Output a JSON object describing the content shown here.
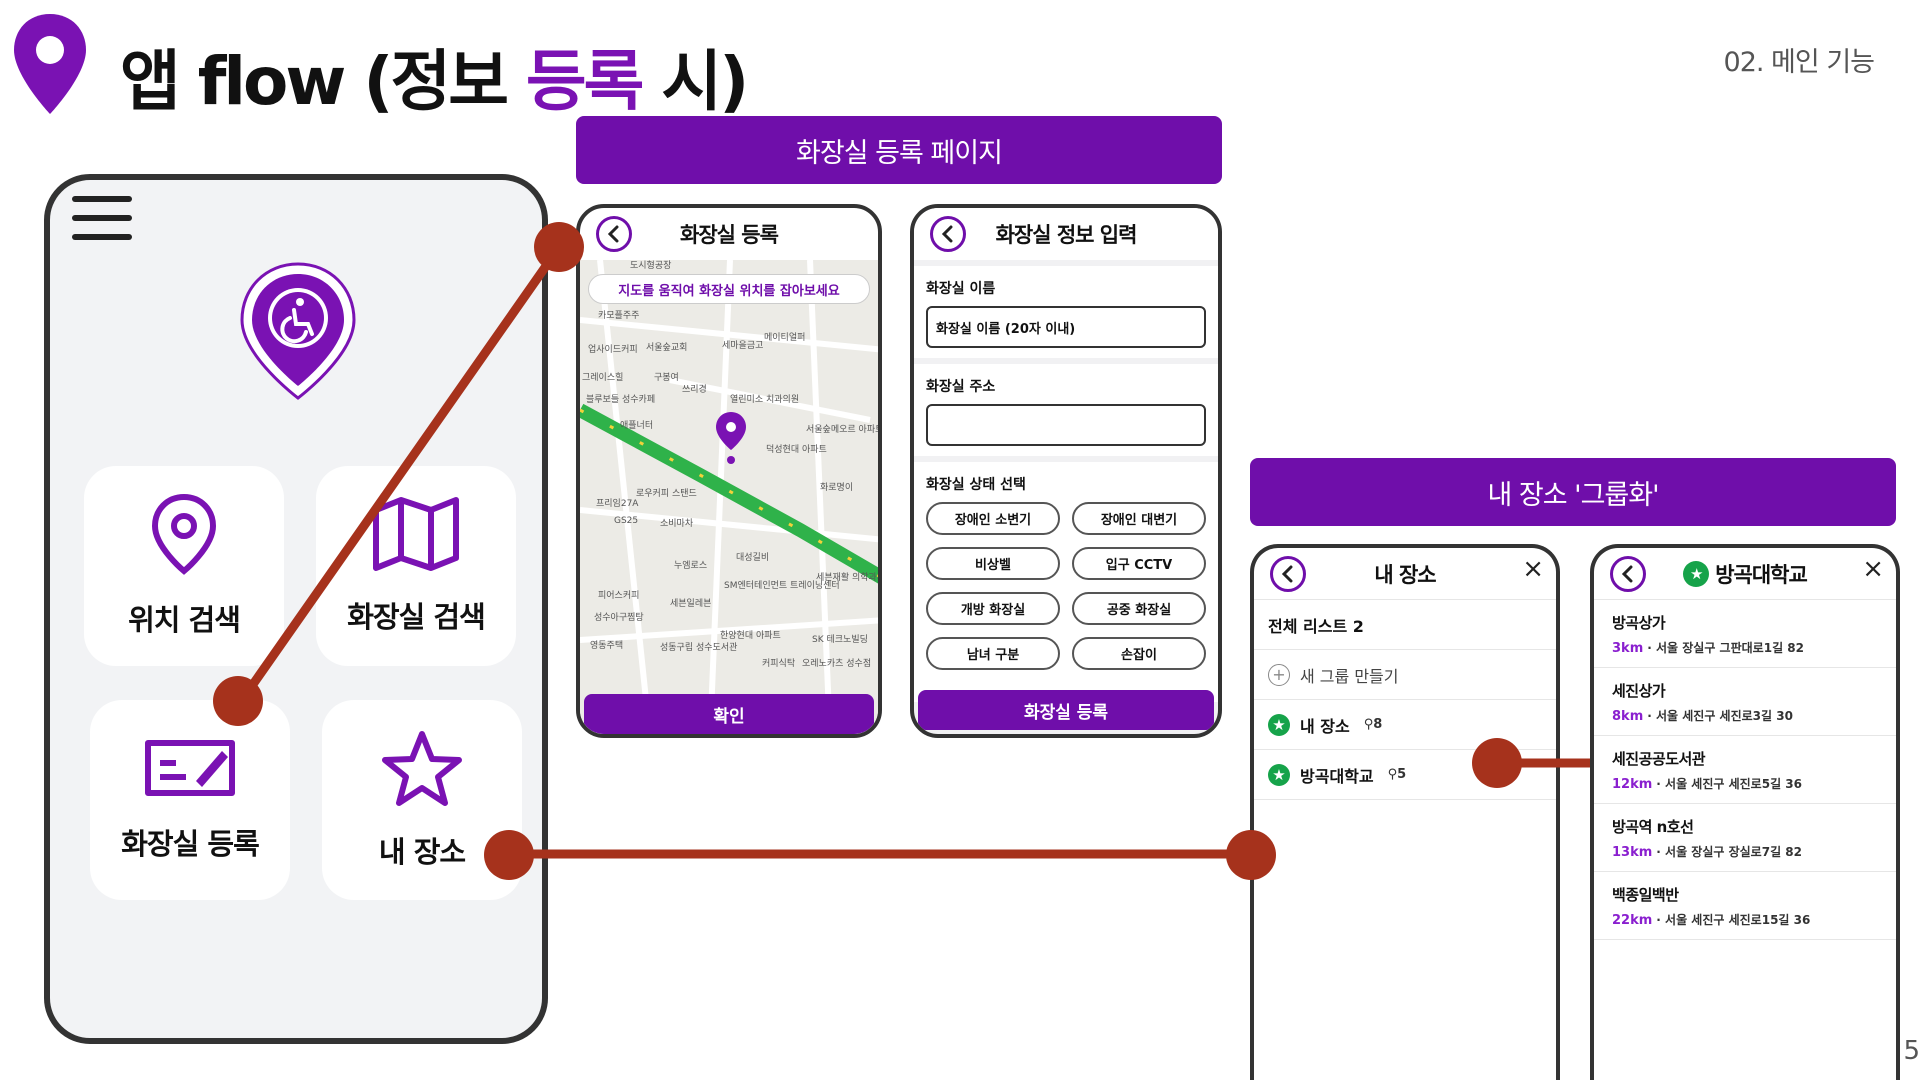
{
  "header": {
    "title_prefix": "앱 flow (정보 ",
    "title_accent": "등록",
    "title_suffix": " 시)",
    "section": "02. 메인 기능",
    "page_number": "5"
  },
  "home": {
    "tiles": [
      {
        "label": "위치 검색",
        "icon": "location-pin-icon"
      },
      {
        "label": "화장실 검색",
        "icon": "map-icon"
      },
      {
        "label": "화장실 등록",
        "icon": "ticket-edit-icon"
      },
      {
        "label": "내 장소",
        "icon": "star-icon"
      }
    ]
  },
  "banners": {
    "register": "화장실 등록 페이지",
    "group": "내 장소 '그룹화'"
  },
  "register_screen": {
    "title": "화장실 등록",
    "hint": "지도를 움직여 화장실 위치를 잡아보세요",
    "confirm": "확인",
    "map_labels": [
      "도시형공장",
      "카모플주주",
      "업사이드커피",
      "서울숲교회",
      "세마을금고",
      "메이티얼퍼",
      "그레이스힐",
      "구봉여",
      "쓰리경",
      "열린미소 치과의원",
      "블루보틀 성수카페",
      "애플너터",
      "덕성현대 아파트",
      "서울숲메오르 아파트",
      "프리임27A",
      "로우커피 스탠드",
      "GS25",
      "소비마차",
      "대성길비",
      "누엠로스",
      "SM엔터테인먼트 트레이닝센터",
      "피어스커피",
      "세븐일레븐",
      "성수아구찜탕",
      "영동주택",
      "성동구립 성수도서관",
      "한양현대 아파트",
      "커피식탁",
      "오레노카츠 성수점",
      "SK 테크노빌딩",
      "세븐재활 의학과의원",
      "화로명이"
    ]
  },
  "info_screen": {
    "title": "화장실 정보 입력",
    "name_label": "화장실 이름",
    "name_placeholder": "화장실 이름 (20자 이내)",
    "address_label": "화장실 주소",
    "address_value": "",
    "status_label": "화장실 상태 선택",
    "chips": [
      "장애인 소변기",
      "장애인 대변기",
      "비상벨",
      "입구 CCTV",
      "개방 화장실",
      "공중 화장실",
      "남녀 구분",
      "손잡이"
    ],
    "submit": "화장실 등록"
  },
  "myplaces_screen": {
    "title": "내 장소",
    "total": "전체 리스트 2",
    "new_group": "새 그룹 만들기",
    "groups": [
      {
        "name": "내 장소",
        "count": "8"
      },
      {
        "name": "방곡대학교",
        "count": "5"
      }
    ]
  },
  "group_screen": {
    "title": "방곡대학교",
    "places": [
      {
        "name": "방곡상가",
        "dist": "3km",
        "addr": "서울 장실구 그판대로1길 82"
      },
      {
        "name": "세진상가",
        "dist": "8km",
        "addr": "서울 세진구 세진로3길 30"
      },
      {
        "name": "세진공공도서관",
        "dist": "12km",
        "addr": "서울 세진구 세진로5길 36"
      },
      {
        "name": "방곡역 n호선",
        "dist": "13km",
        "addr": "서울 장실구 장실로7길 82"
      },
      {
        "name": "백종일백반",
        "dist": "22km",
        "addr": "서울 세진구 세진로15길 36"
      }
    ]
  },
  "colors": {
    "brand_purple": "#6f0eaa",
    "connector": "#a6321c",
    "star_green": "#16a34a"
  }
}
